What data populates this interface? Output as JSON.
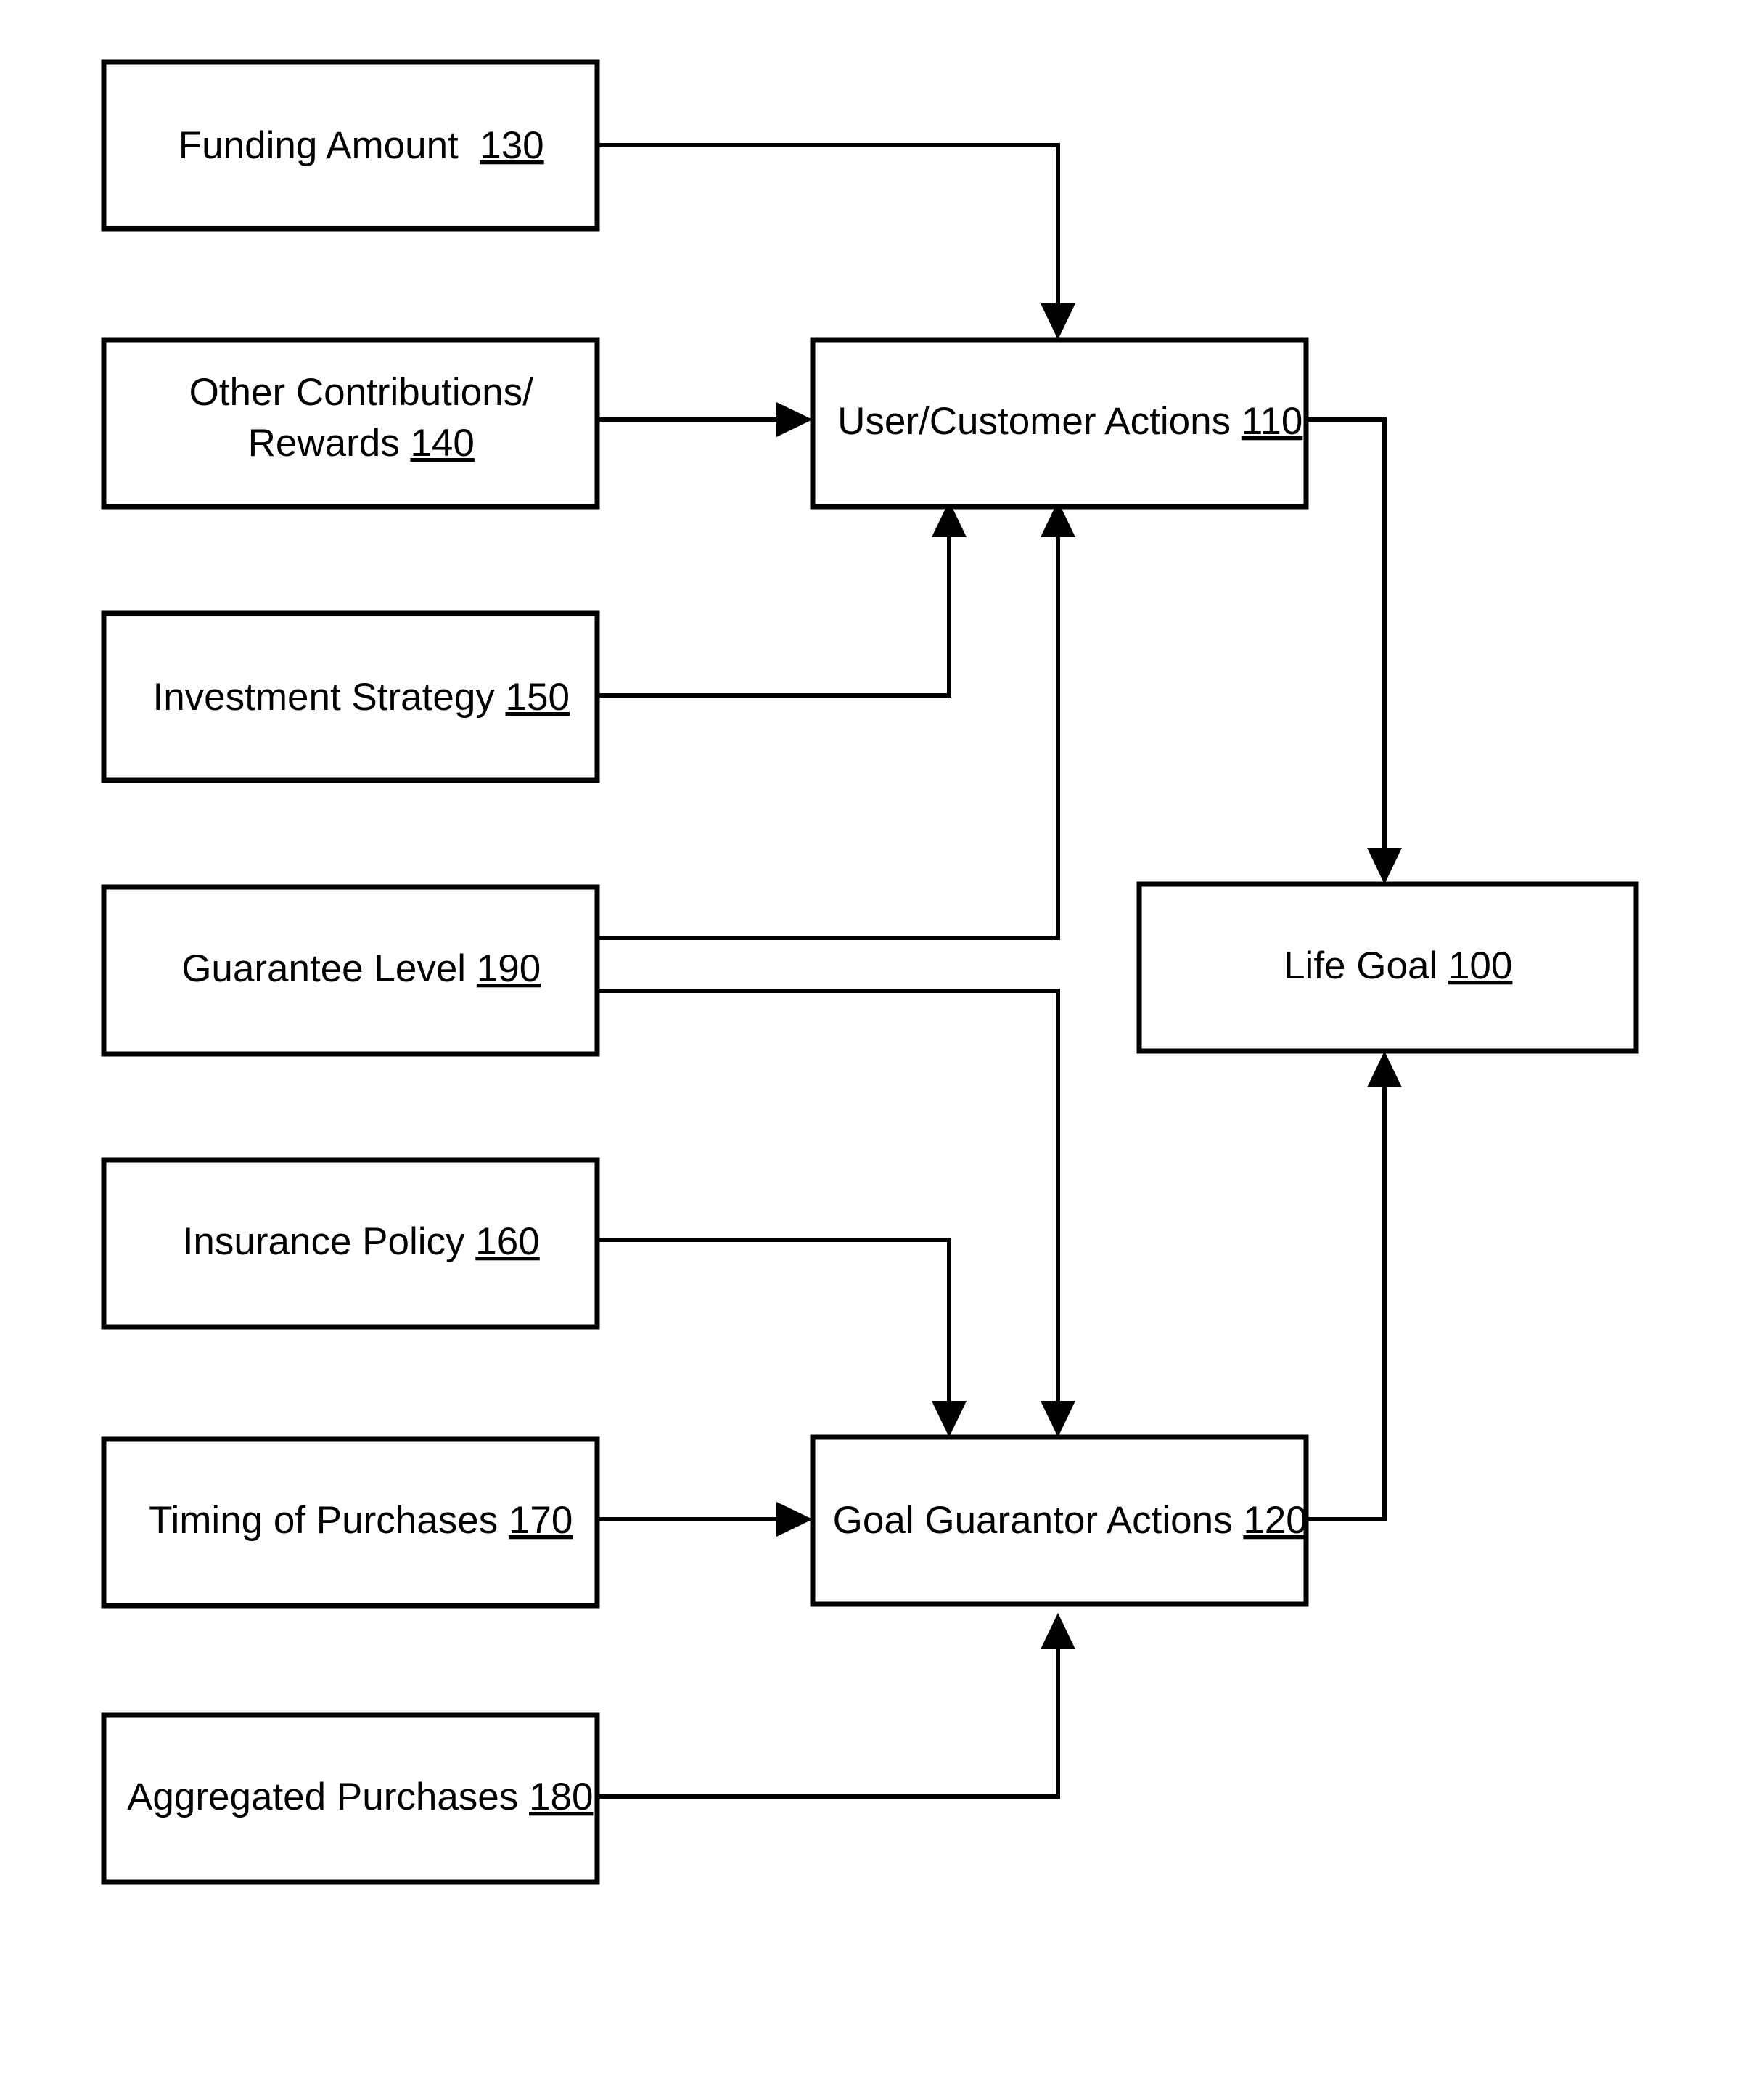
{
  "figure": {
    "type": "patent-flow-diagram",
    "background_color": "#ffffff",
    "line_color": "#000000"
  },
  "nodes": [
    {
      "id": "funding_amount",
      "label": "Funding Amount",
      "ref": "130",
      "full_text": "Funding Amount  130",
      "lines": [
        "Funding Amount  130"
      ],
      "column": "left"
    },
    {
      "id": "other_contributions",
      "label": "Other Contributions/ Rewards",
      "ref": "140",
      "full_text": "Other Contributions/ Rewards 140",
      "lines": [
        "Other Contributions/",
        "Rewards 140"
      ],
      "column": "left"
    },
    {
      "id": "investment_strategy",
      "label": "Investment Strategy",
      "ref": "150",
      "full_text": "Investment Strategy 150",
      "lines": [
        "Investment Strategy 150"
      ],
      "column": "left"
    },
    {
      "id": "guarantee_level",
      "label": "Guarantee Level",
      "ref": "190",
      "full_text": "Guarantee Level 190",
      "lines": [
        "Guarantee Level 190"
      ],
      "column": "left"
    },
    {
      "id": "insurance_policy",
      "label": "Insurance Policy",
      "ref": "160",
      "full_text": "Insurance Policy 160",
      "lines": [
        "Insurance Policy 160"
      ],
      "column": "left"
    },
    {
      "id": "timing_of_purchases",
      "label": "Timing of Purchases",
      "ref": "170",
      "full_text": "Timing of Purchases 170",
      "lines": [
        "Timing of Purchases 170"
      ],
      "column": "left"
    },
    {
      "id": "aggregated_purchases",
      "label": "Aggregated Purchases",
      "ref": "180",
      "full_text": "Aggregated Purchases 180",
      "lines": [
        "Aggregated Purchases 180"
      ],
      "column": "left"
    },
    {
      "id": "user_customer_actions",
      "label": "User/Customer Actions",
      "ref": "110",
      "full_text": "User/Customer Actions 110",
      "lines": [
        "User/Customer Actions 110"
      ],
      "column": "center"
    },
    {
      "id": "goal_guarantor_actions",
      "label": "Goal Guarantor Actions",
      "ref": "120",
      "full_text": "Goal Guarantor Actions 120",
      "lines": [
        "Goal Guarantor Actions 120"
      ],
      "column": "center"
    },
    {
      "id": "life_goal",
      "label": "Life Goal",
      "ref": "100",
      "full_text": "Life Goal 100",
      "lines": [
        "Life Goal 100"
      ],
      "column": "right"
    }
  ],
  "edges": [
    {
      "id": "e1",
      "from": "funding_amount",
      "to": "user_customer_actions",
      "to_side": "top"
    },
    {
      "id": "e2",
      "from": "other_contributions",
      "to": "user_customer_actions",
      "to_side": "left"
    },
    {
      "id": "e3",
      "from": "investment_strategy",
      "to": "user_customer_actions",
      "to_side": "bottom"
    },
    {
      "id": "e4",
      "from": "guarantee_level",
      "to": "user_customer_actions",
      "to_side": "bottom"
    },
    {
      "id": "e5",
      "from": "guarantee_level",
      "to": "goal_guarantor_actions",
      "to_side": "top"
    },
    {
      "id": "e6",
      "from": "insurance_policy",
      "to": "goal_guarantor_actions",
      "to_side": "top"
    },
    {
      "id": "e7",
      "from": "timing_of_purchases",
      "to": "goal_guarantor_actions",
      "to_side": "left"
    },
    {
      "id": "e8",
      "from": "aggregated_purchases",
      "to": "goal_guarantor_actions",
      "to_side": "bottom"
    },
    {
      "id": "e9",
      "from": "user_customer_actions",
      "to": "life_goal",
      "to_side": "top"
    },
    {
      "id": "e10",
      "from": "goal_guarantor_actions",
      "to": "life_goal",
      "to_side": "bottom"
    }
  ]
}
